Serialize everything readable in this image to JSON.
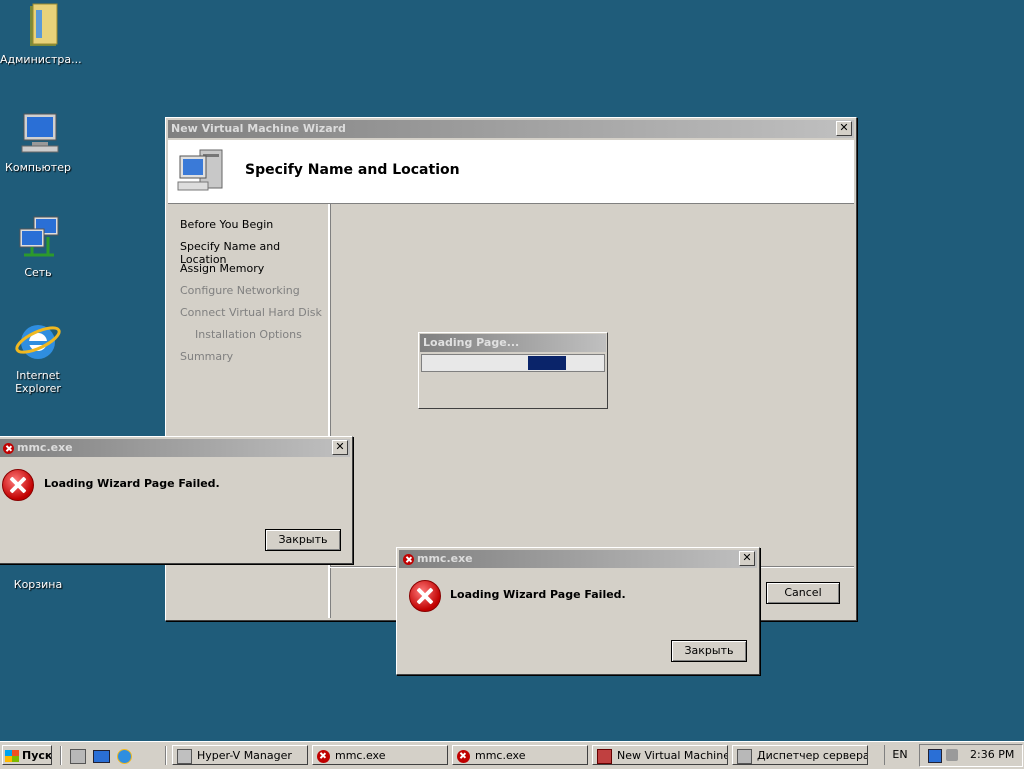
{
  "colors": {
    "desktop": "#1f5c7a",
    "progress": "#0a246a"
  },
  "desktop_icons": [
    {
      "label": "Администра...",
      "icon": "folder-icon"
    },
    {
      "label": "Компьютер",
      "icon": "computer-icon"
    },
    {
      "label": "Сеть",
      "icon": "network-icon"
    },
    {
      "label": "Internet Explorer",
      "icon": "internet-explorer-icon"
    },
    {
      "label": "Корзина",
      "icon": "recycle-bin-icon"
    }
  ],
  "wizard": {
    "title": "New Virtual Machine Wizard",
    "header": "Specify Name and Location",
    "steps": [
      {
        "label": "Before You Begin",
        "state": "enabled"
      },
      {
        "label": "Specify Name and Location",
        "state": "enabled"
      },
      {
        "label": "Assign Memory",
        "state": "enabled"
      },
      {
        "label": "Configure Networking",
        "state": "disabled"
      },
      {
        "label": "Connect Virtual Hard Disk",
        "state": "disabled"
      },
      {
        "label": "Installation Options",
        "state": "disabled"
      },
      {
        "label": "Summary",
        "state": "disabled"
      }
    ],
    "cancel_label": "Cancel",
    "loading": {
      "title": "Loading Page..."
    }
  },
  "error_dialogs": [
    {
      "title": "mmc.exe",
      "message": "Loading Wizard Page Failed.",
      "button_label": "Закрыть"
    },
    {
      "title": "mmc.exe",
      "message": "Loading Wizard Page Failed.",
      "button_label": "Закрыть"
    }
  ],
  "taskbar": {
    "start_label": "Пуск",
    "buttons": [
      {
        "label": "Hyper-V Manager",
        "icon": "hyperv-icon"
      },
      {
        "label": "mmc.exe",
        "icon": "error-icon"
      },
      {
        "label": "mmc.exe",
        "icon": "error-icon"
      },
      {
        "label": "New Virtual Machine...",
        "icon": "wizard-icon"
      },
      {
        "label": "Диспетчер сервера",
        "icon": "server-manager-icon"
      }
    ],
    "language": "EN",
    "clock": "2:36 PM"
  }
}
